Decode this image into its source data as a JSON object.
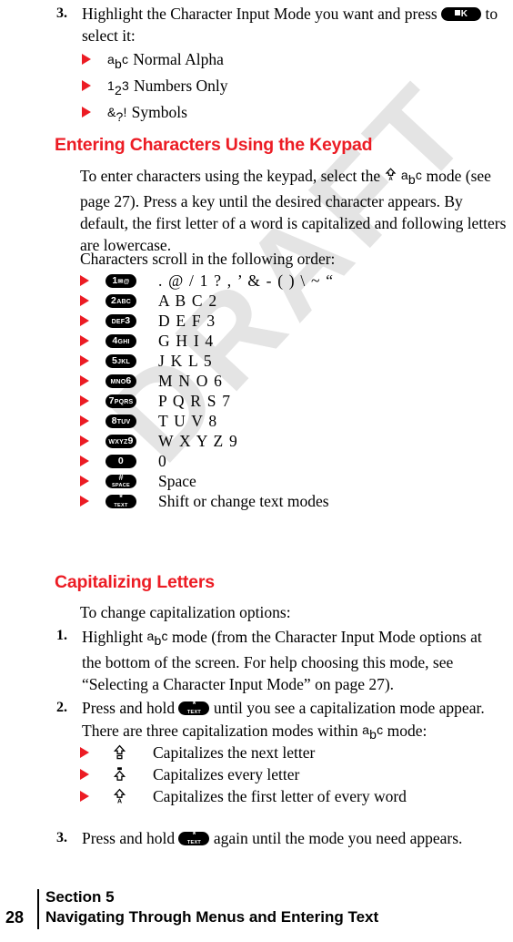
{
  "watermark": {
    "text": "DRAFT"
  },
  "step3_top": {
    "number": "3.",
    "line1_pre": "Highlight the Character Input Mode you want and press",
    "key_ok": "OK",
    "line1_post": "to",
    "line2": "select it:",
    "modes": [
      {
        "glyph": "abc",
        "label": "Normal Alpha"
      },
      {
        "glyph": "123",
        "label": "Numbers Only"
      },
      {
        "glyph": "&?!",
        "label": "Symbols"
      }
    ]
  },
  "section_keypad": {
    "heading": "Entering Characters Using the Keypad",
    "para1_part1": "To enter characters using the keypad, select the",
    "para1_glyph": "abc",
    "para1_part2": "mode",
    "para1_part3": "(see page 27). Press a key until the desired character appears. By default, the first letter of a word is capitalized and following letters are lowercase.",
    "para2": "Characters scroll in the following order:",
    "rows": [
      {
        "key": {
          "num": "1",
          "sub": "✉ @"
        },
        "chars": ". @ / 1 ? , ’ & - ( ) \\  ~  “"
      },
      {
        "key": {
          "num": "2",
          "sub": "ABC"
        },
        "chars": "A B C 2"
      },
      {
        "key": {
          "sub": "DEF",
          "num": "3"
        },
        "chars": "D E F 3"
      },
      {
        "key": {
          "num": "4",
          "sub": "GHI"
        },
        "chars": "G H I 4"
      },
      {
        "key": {
          "num": "5",
          "sub": "JKL"
        },
        "chars": "J K L 5"
      },
      {
        "key": {
          "sub": "MNO",
          "num": "6"
        },
        "chars": "M N O 6"
      },
      {
        "key": {
          "num": "7",
          "sub": "PQRS"
        },
        "chars": "P Q R S 7"
      },
      {
        "key": {
          "num": "8",
          "sub": "TUV"
        },
        "chars": "T U V 8"
      },
      {
        "key": {
          "sub": "WXYZ",
          "num": "9"
        },
        "chars": "W X Y Z 9"
      },
      {
        "key": {
          "num": "0",
          "sub": ""
        },
        "chars": "0"
      },
      {
        "key": {
          "top": "#",
          "bot": "SPACE"
        },
        "chars": "Space"
      },
      {
        "key": {
          "top": "*",
          "bot": "TEXT"
        },
        "chars": "Shift or change text modes"
      }
    ]
  },
  "section_caps": {
    "heading": "Capitalizing Letters",
    "intro": "To change capitalization options:",
    "step1": {
      "number": "1.",
      "pre": "Highlight",
      "glyph": "abc",
      "post": "mode (from the Character Input Mode options at the bottom of the screen. For help choosing this mode, see “Selecting a Character Input Mode” on page 27)."
    },
    "step2": {
      "number": "2.",
      "pre": "Press and hold",
      "key": {
        "top": "*",
        "bot": "TEXT"
      },
      "mid": "until you see a capitalization mode appear. There are three capitalization modes within",
      "glyph": "abc",
      "post": "mode:",
      "modes": [
        {
          "icon": "shift-next-letter-icon",
          "label": "Capitalizes the next letter"
        },
        {
          "icon": "shift-every-letter-icon",
          "label": "Capitalizes every letter"
        },
        {
          "icon": "shift-first-letter-word-icon",
          "label": "Capitalizes the first letter of every word"
        }
      ]
    },
    "step3": {
      "number": "3.",
      "pre": "Press and hold",
      "key": {
        "top": "*",
        "bot": "TEXT"
      },
      "post": "again until the mode you need appears."
    }
  },
  "footer": {
    "page_number": "28",
    "line1": "Section 5",
    "line2": "Navigating Through Menus and Entering Text"
  },
  "colors": {
    "heading_red": "#ec1c24",
    "bullet_red": "#ec1c24",
    "watermark_gray": "#e4e4e4",
    "text_black": "#000000"
  }
}
